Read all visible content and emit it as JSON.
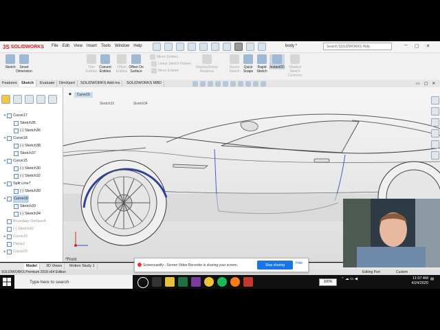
{
  "app": {
    "logo_text": "SOLIDWORKS",
    "menu": [
      "File",
      "Edit",
      "View",
      "Insert",
      "Tools",
      "Window",
      "Help"
    ],
    "document_title": "body *",
    "search_placeholder": "Search SOLIDWORKS Help"
  },
  "ribbon": {
    "buttons": [
      {
        "label": "Sketch"
      },
      {
        "label": "Smart Dimension"
      },
      {
        "label": "Trim Entities"
      },
      {
        "label": "Convert Entities"
      },
      {
        "label": "Offset Entities"
      },
      {
        "label": "Offset On Surface"
      },
      {
        "label": "Mirror Entities"
      },
      {
        "label": "Linear Sketch Pattern"
      },
      {
        "label": "Move Entities"
      },
      {
        "label": "Display/Delete Relations"
      },
      {
        "label": "Repair Sketch"
      },
      {
        "label": "Quick Snaps"
      },
      {
        "label": "Rapid Sketch"
      },
      {
        "label": "Instant2D"
      },
      {
        "label": "Shaded Sketch Contours"
      }
    ]
  },
  "tabs": [
    "Features",
    "Sketch",
    "Evaluate",
    "DimXpert",
    "SOLIDWORKS Add-Ins",
    "SOLIDWORKS MBD"
  ],
  "active_tab": "Sketch",
  "breadcrumb": {
    "current": "Curve16"
  },
  "subtabs": [
    "Sketch33",
    "Sketch34"
  ],
  "tree": [
    {
      "label": "Curve17",
      "level": 0,
      "state": "normal",
      "twisty": "▾"
    },
    {
      "label": "Sketch35",
      "level": 1,
      "state": "normal",
      "twisty": ""
    },
    {
      "label": "(-) Sketch36",
      "level": 1,
      "state": "normal",
      "twisty": ""
    },
    {
      "label": "Curve18",
      "level": 0,
      "state": "normal",
      "twisty": "▾"
    },
    {
      "label": "(-) Sketch38",
      "level": 1,
      "state": "normal",
      "twisty": ""
    },
    {
      "label": "Sketch37",
      "level": 1,
      "state": "normal",
      "twisty": ""
    },
    {
      "label": "Curve15",
      "level": 0,
      "state": "normal",
      "twisty": "▾"
    },
    {
      "label": "(-) Sketch30",
      "level": 1,
      "state": "normal",
      "twisty": ""
    },
    {
      "label": "(-) Sketch32",
      "level": 1,
      "state": "normal",
      "twisty": ""
    },
    {
      "label": "Split Line7",
      "level": 0,
      "state": "normal",
      "twisty": "▾"
    },
    {
      "label": "(-) Sketch39",
      "level": 1,
      "state": "normal",
      "twisty": ""
    },
    {
      "label": "Curve16",
      "level": 0,
      "state": "selected",
      "twisty": "▾"
    },
    {
      "label": "Sketch33",
      "level": 1,
      "state": "normal",
      "twisty": ""
    },
    {
      "label": "(-) Sketch34",
      "level": 1,
      "state": "normal",
      "twisty": ""
    },
    {
      "label": "Boundary-Surface4",
      "level": 0,
      "state": "dim",
      "twisty": ""
    },
    {
      "label": "(-) Sketch42",
      "level": 0,
      "state": "dim",
      "twisty": ""
    },
    {
      "label": "Curve19",
      "level": 0,
      "state": "dim",
      "twisty": "▸"
    },
    {
      "label": "Plane2",
      "level": 0,
      "state": "dim",
      "twisty": ""
    },
    {
      "label": "Curve20",
      "level": 0,
      "state": "dim",
      "twisty": "▸"
    }
  ],
  "viewport": {
    "view_name": "*Front"
  },
  "bottom_tabs": [
    "Model",
    "3D Views",
    "Motion Study 1"
  ],
  "status": {
    "left": "SOLIDWORKS Premium 2018 x64 Edition",
    "editing": "Editing Part",
    "units": "Custom"
  },
  "screencast": {
    "message": "Screencastify - Screen Video Recorder is sharing your screen.",
    "stop_label": "Stop sharing",
    "hide_label": "Hide"
  },
  "taskbar": {
    "search_placeholder": "Type here to search",
    "battery": "100%",
    "time": "11:07 AM",
    "date": "4/24/2020"
  },
  "colors": {
    "accent": "#1a73e8",
    "selection": "#bcd3ee",
    "brand": "#d02020"
  }
}
